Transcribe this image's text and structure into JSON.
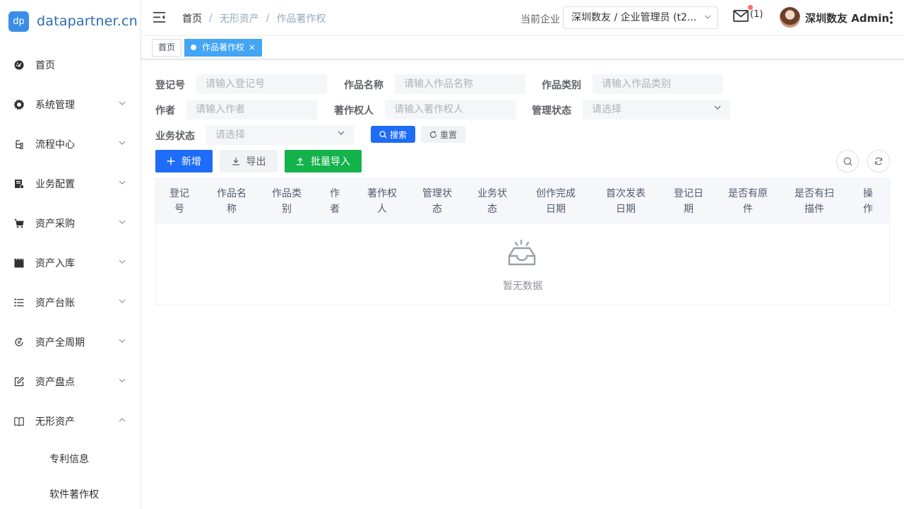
{
  "app": {
    "logo_badge": "dp",
    "logo_text": "datapartner.cn"
  },
  "sidebar": {
    "items": [
      {
        "label": "首页",
        "icon": "dashboard-icon",
        "expandable": false
      },
      {
        "label": "系统管理",
        "icon": "gear-icon",
        "expandable": true
      },
      {
        "label": "流程中心",
        "icon": "workflow-icon",
        "expandable": true
      },
      {
        "label": "业务配置",
        "icon": "config-icon",
        "expandable": true
      },
      {
        "label": "资产采购",
        "icon": "cart-icon",
        "expandable": true
      },
      {
        "label": "资产入库",
        "icon": "clapper-icon",
        "expandable": true
      },
      {
        "label": "资产台账",
        "icon": "list-icon",
        "expandable": true
      },
      {
        "label": "资产全周期",
        "icon": "cycle-icon",
        "expandable": true
      },
      {
        "label": "资产盘点",
        "icon": "edit-icon",
        "expandable": true
      },
      {
        "label": "无形资产",
        "icon": "book-icon",
        "expandable": true,
        "expanded": true
      }
    ],
    "submenu": [
      {
        "label": "专利信息"
      },
      {
        "label": "软件著作权"
      }
    ]
  },
  "header": {
    "breadcrumb": [
      "首页",
      "无形资产",
      "作品著作权"
    ],
    "company_label": "当前企业",
    "company_value": "深圳数友 / 企业管理员 (t2...",
    "mail_count": "(1)",
    "username": "深圳数友 Admin"
  },
  "tags": {
    "home": "首页",
    "active": "作品著作权"
  },
  "search": {
    "fields": {
      "reg_no": {
        "label": "登记号",
        "placeholder": "请输入登记号"
      },
      "work_name": {
        "label": "作品名称",
        "placeholder": "请输入作品名称"
      },
      "work_category": {
        "label": "作品类别",
        "placeholder": "请输入作品类别"
      },
      "author": {
        "label": "作者",
        "placeholder": "请输入作者"
      },
      "owner": {
        "label": "著作权人",
        "placeholder": "请输入著作权人"
      },
      "manage_status": {
        "label": "管理状态",
        "placeholder": "请选择"
      },
      "business_status": {
        "label": "业务状态",
        "placeholder": "请选择"
      }
    },
    "search_button": "搜索",
    "reset_button": "重置"
  },
  "toolbar": {
    "add": "新增",
    "export": "导出",
    "import": "批量导入"
  },
  "table": {
    "columns": [
      [
        "登记",
        "号"
      ],
      [
        "作品名",
        "称"
      ],
      [
        "作品类",
        "别"
      ],
      [
        "作",
        "者"
      ],
      [
        "著作权",
        "人"
      ],
      [
        "管理状",
        "态"
      ],
      [
        "业务状",
        "态"
      ],
      [
        "创作完成",
        "日期"
      ],
      [
        "首次发表",
        "日期"
      ],
      [
        "登记日",
        "期"
      ],
      [
        "是否有原",
        "件"
      ],
      [
        "是否有扫",
        "描件"
      ],
      [
        "操",
        "作"
      ]
    ],
    "empty_text": "暂无数据"
  },
  "colors": {
    "primary": "#1e6cf7",
    "success": "#13b24a",
    "tag_active": "#42a5f5",
    "badge_dot": "#f56c6c"
  }
}
